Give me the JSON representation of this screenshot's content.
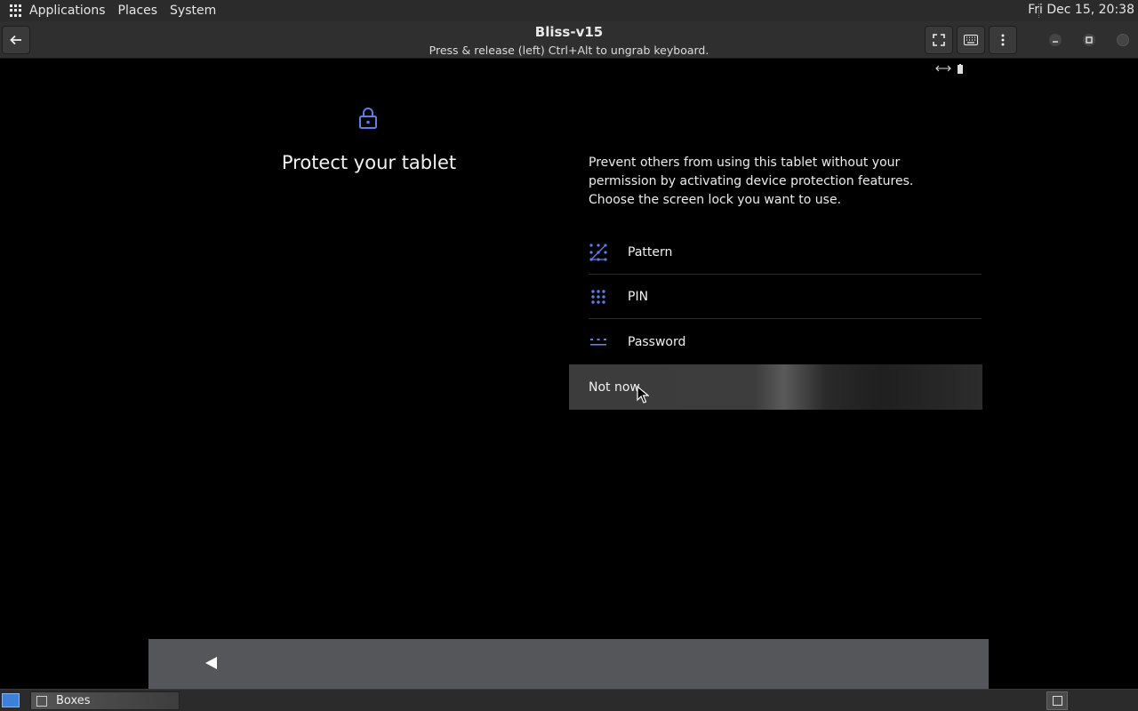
{
  "top_panel": {
    "menus": [
      "Applications",
      "Places",
      "System"
    ],
    "clock": "Fri Dec 15, 20:38"
  },
  "header": {
    "title": "Bliss-v15",
    "subtitle": "Press & release (left) Ctrl+Alt to ungrab keyboard.",
    "icons": [
      "back-arrow-icon",
      "fullscreen-icon",
      "keyboard-icon",
      "more-vert-icon",
      "minimize-icon",
      "maximize-icon",
      "close-icon"
    ]
  },
  "android": {
    "title": "Protect your tablet",
    "description": "Prevent others from using this tablet without your permission by activating device protection features. Choose the screen lock you want to use.",
    "options": [
      {
        "label": "Pattern",
        "icon": "pattern-icon"
      },
      {
        "label": "PIN",
        "icon": "pin-icon"
      },
      {
        "label": "Password",
        "icon": "password-icon"
      }
    ],
    "not_now": "Not now",
    "accent_color": "#5b7fe6"
  },
  "taskbar": {
    "window_label": "Boxes"
  }
}
